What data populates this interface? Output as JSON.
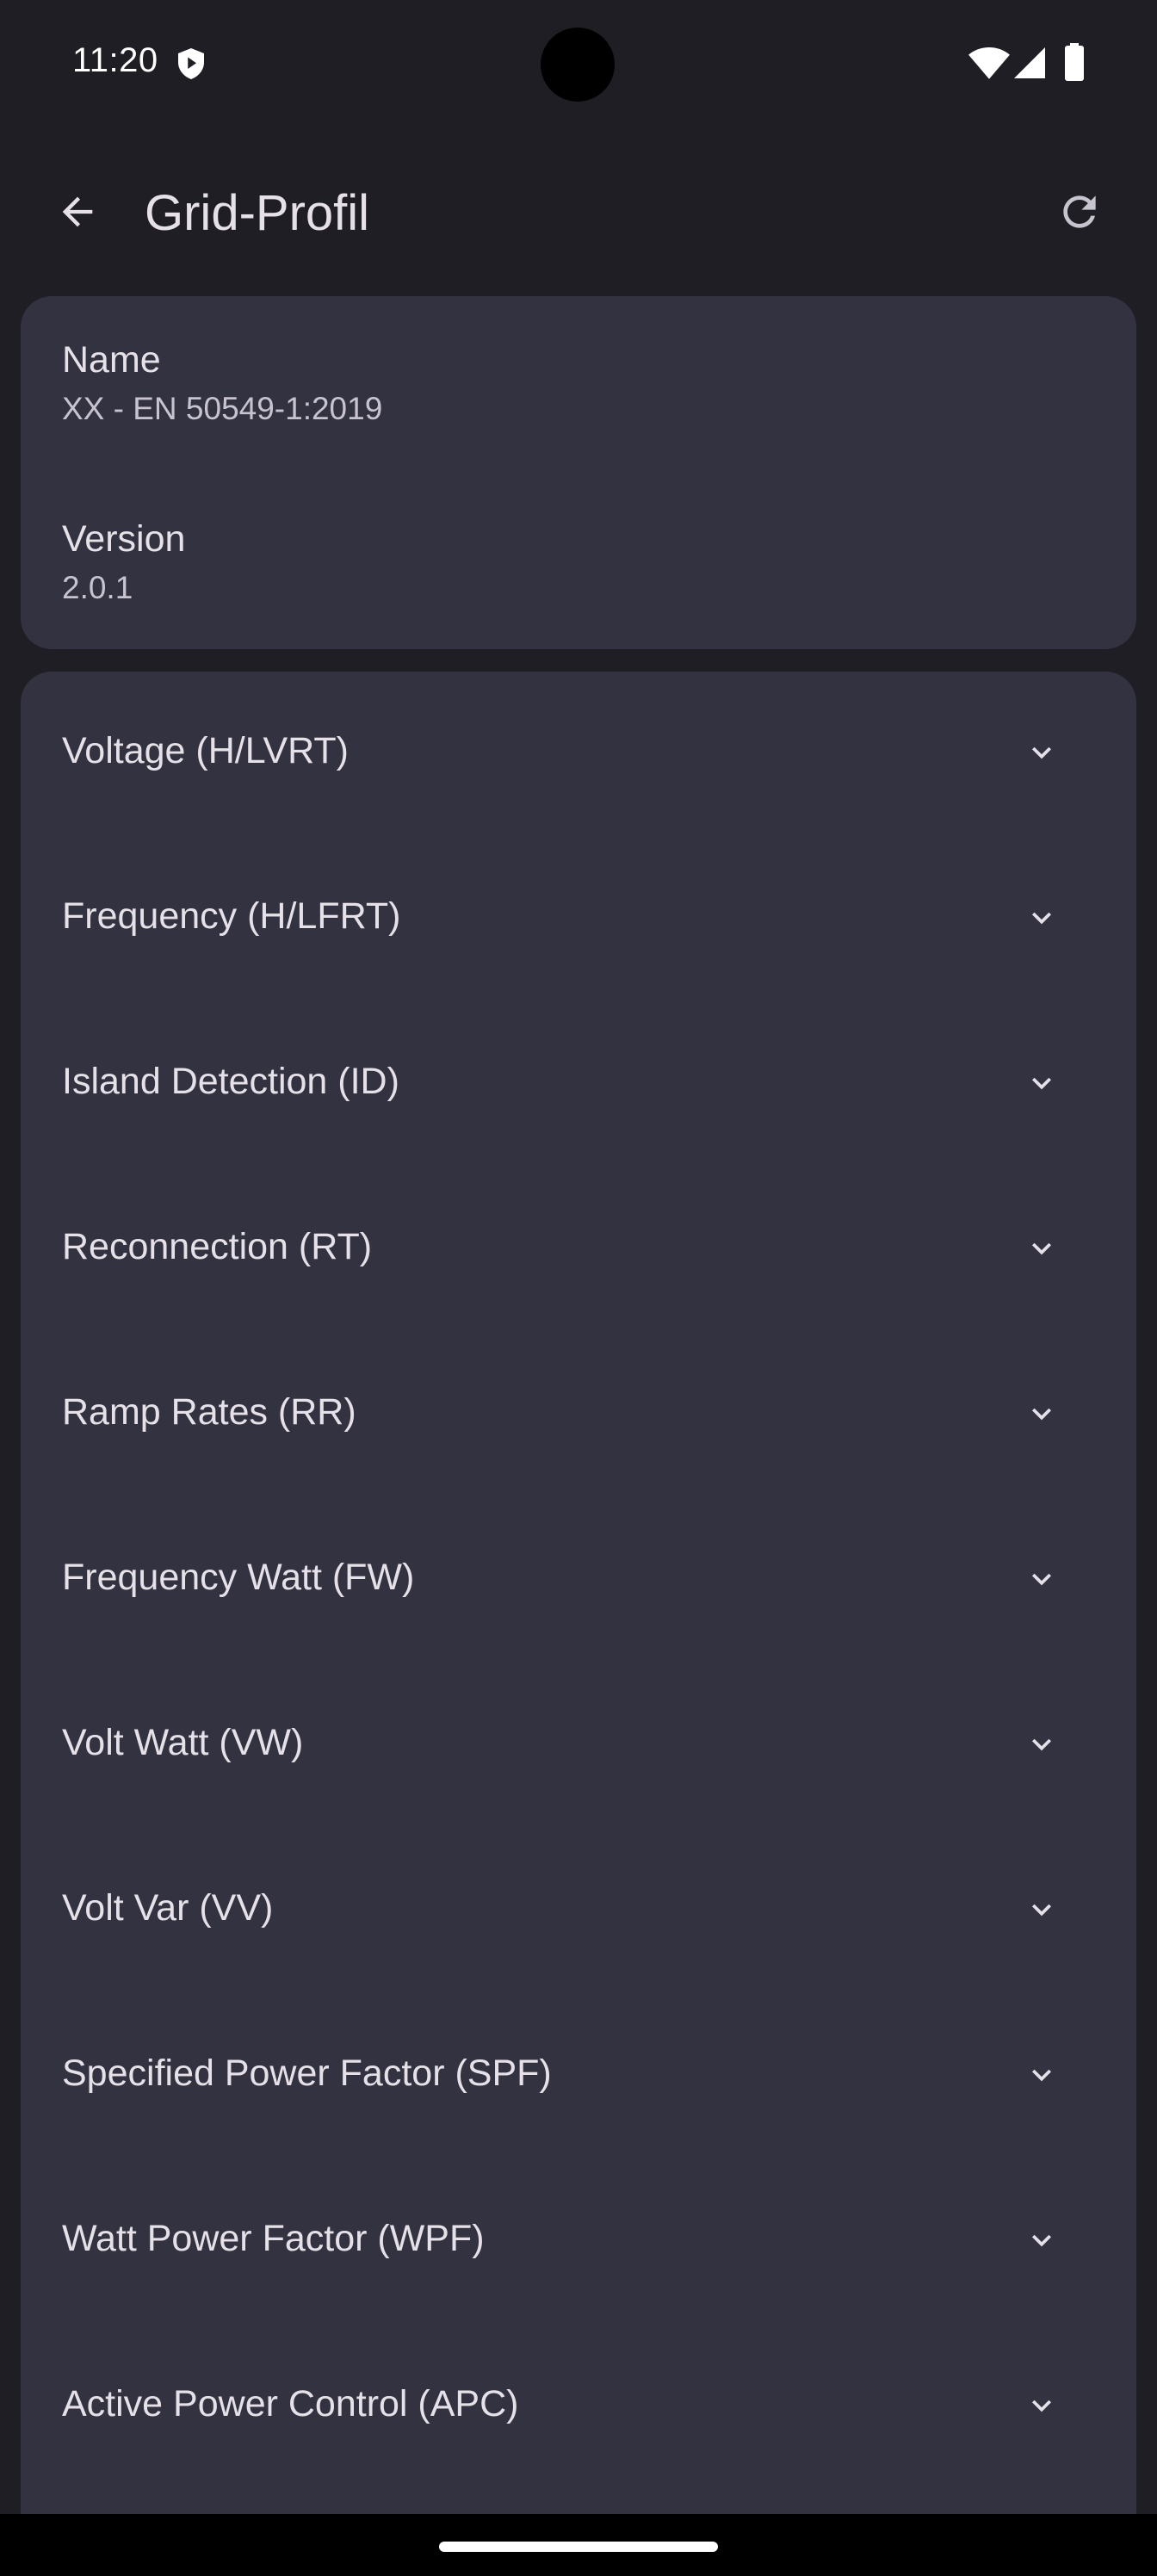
{
  "status_bar": {
    "time": "11:20"
  },
  "app_bar": {
    "title": "Grid-Profil",
    "back_icon": "arrow-back-icon",
    "refresh_icon": "refresh-icon"
  },
  "info": {
    "name_label": "Name",
    "name_value": "XX - EN 50549-1:2019",
    "version_label": "Version",
    "version_value": "2.0.1"
  },
  "sections": [
    {
      "label": "Voltage (H/LVRT)"
    },
    {
      "label": "Frequency (H/LFRT)"
    },
    {
      "label": "Island Detection (ID)"
    },
    {
      "label": "Reconnection (RT)"
    },
    {
      "label": "Ramp Rates (RR)"
    },
    {
      "label": "Frequency Watt (FW)"
    },
    {
      "label": "Volt Watt (VW)"
    },
    {
      "label": "Volt Var (VV)"
    },
    {
      "label": "Specified Power Factor (SPF)"
    },
    {
      "label": "Watt Power Factor (WPF)"
    },
    {
      "label": "Active Power Control (APC)"
    }
  ],
  "colors": {
    "background": "#1f1e24",
    "card": "#333240",
    "text_primary": "#e6e1e8",
    "text_secondary": "#c7c3cf"
  }
}
